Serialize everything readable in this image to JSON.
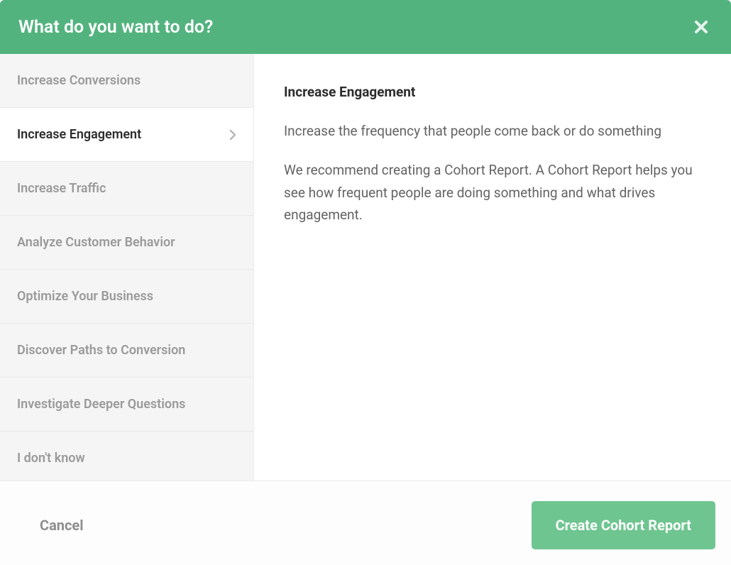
{
  "header": {
    "title": "What do you want to do?"
  },
  "sidebar": {
    "items": [
      {
        "label": "Increase Conversions",
        "active": false
      },
      {
        "label": "Increase Engagement",
        "active": true
      },
      {
        "label": "Increase Traffic",
        "active": false
      },
      {
        "label": "Analyze Customer Behavior",
        "active": false
      },
      {
        "label": "Optimize Your Business",
        "active": false
      },
      {
        "label": "Discover Paths to Conversion",
        "active": false
      },
      {
        "label": "Investigate Deeper Questions",
        "active": false
      },
      {
        "label": "I don't know",
        "active": false
      }
    ]
  },
  "detail": {
    "title": "Increase Engagement",
    "subtitle": "Increase the frequency that people come back or do something",
    "description": "We recommend creating a Cohort Report. A Cohort Report helps you see how frequent people are doing something and what drives engagement."
  },
  "footer": {
    "cancel_label": "Cancel",
    "primary_label": "Create Cohort Report"
  },
  "colors": {
    "header_bg": "#53b37f",
    "primary_button": "#6ec590"
  }
}
